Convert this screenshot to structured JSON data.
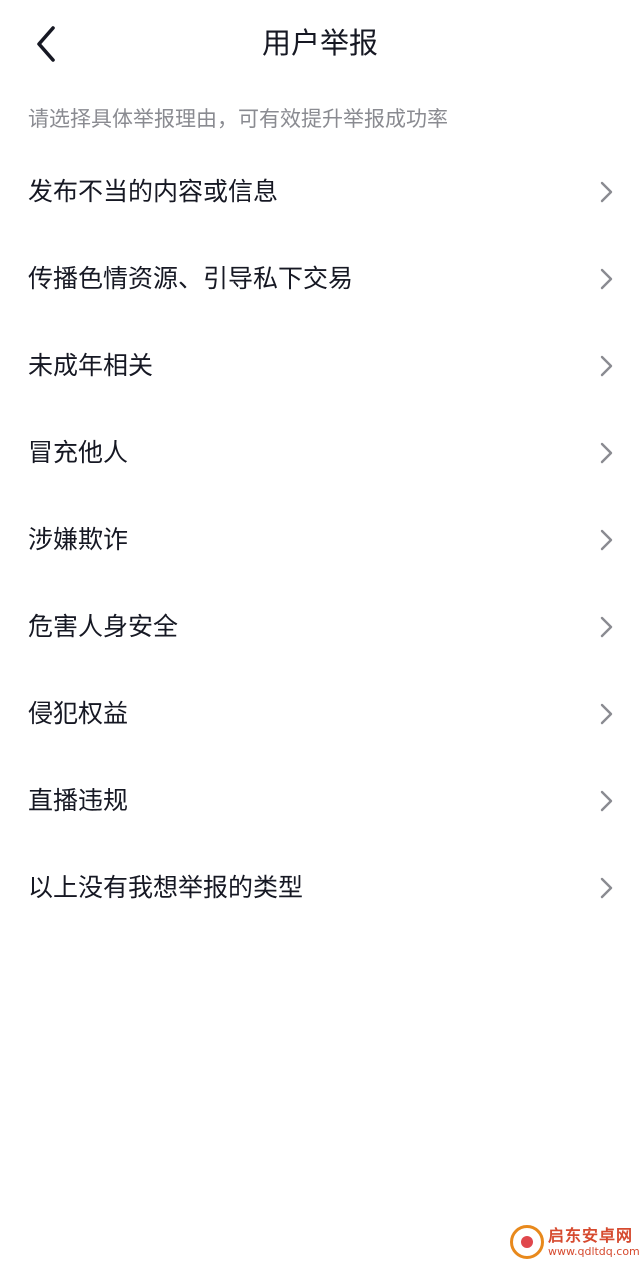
{
  "header": {
    "title": "用户举报",
    "back_icon": "chevron-left-icon"
  },
  "subtitle": "请选择具体举报理由，可有效提升举报成功率",
  "reasons": [
    {
      "label": "发布不当的内容或信息"
    },
    {
      "label": "传播色情资源、引导私下交易"
    },
    {
      "label": "未成年相关"
    },
    {
      "label": "冒充他人"
    },
    {
      "label": "涉嫌欺诈"
    },
    {
      "label": "危害人身安全"
    },
    {
      "label": "侵犯权益"
    },
    {
      "label": "直播违规"
    },
    {
      "label": "以上没有我想举报的类型"
    }
  ],
  "item_icon": "chevron-right-icon",
  "watermark": {
    "name": "启东安卓网",
    "url": "www.qdltdq.com"
  },
  "colors": {
    "text_primary": "#161823",
    "text_secondary": "#8a8b91",
    "chevron": "#8a8b91",
    "background": "#ffffff"
  }
}
